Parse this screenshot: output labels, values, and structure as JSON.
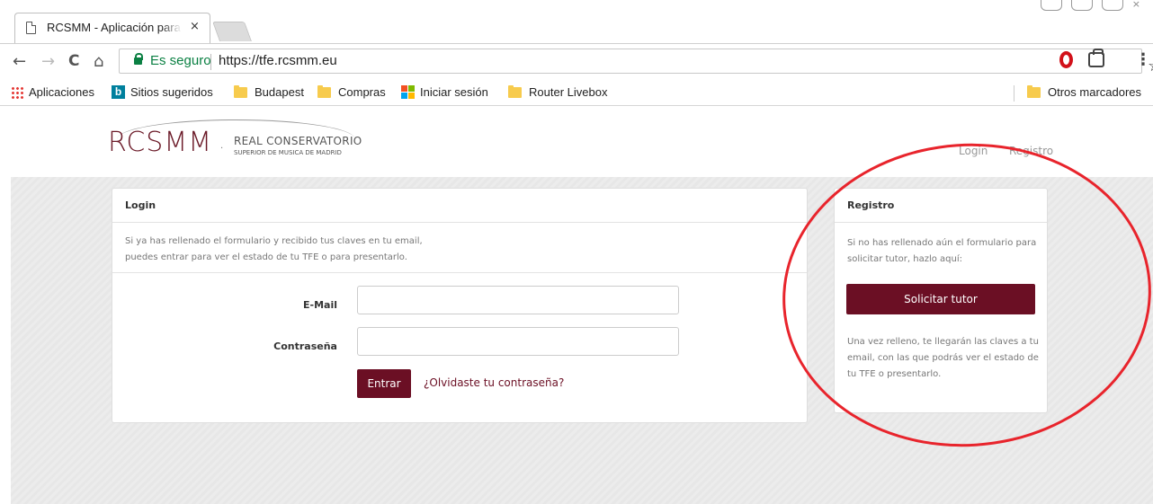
{
  "browser": {
    "tab_title": "RCSMM - Aplicación para",
    "tab_close": "×",
    "window_close": "×",
    "back": "←",
    "forward": "→",
    "reload": "C",
    "home": "⌂",
    "secure_label": "Es seguro",
    "url": "https://tfe.rcsmm.eu",
    "star": "☆",
    "menu": "⋮",
    "bookmarks": [
      {
        "label": "Aplicaciones"
      },
      {
        "label": "Sitios sugeridos"
      },
      {
        "label": "Budapest"
      },
      {
        "label": "Compras"
      },
      {
        "label": "Iniciar sesión"
      },
      {
        "label": "Router Livebox"
      }
    ],
    "other_bookmarks": "Otros marcadores",
    "secure_color": "#0b8043"
  },
  "site": {
    "logo_word": "RCSMM",
    "logo_dot": "·",
    "logo_line1": "REAL CONSERVATORIO",
    "logo_line2": "SUPERIOR DE MUSICA DE MADRID",
    "nav_login": "Login",
    "nav_registro": "Registro",
    "brand_color": "#6b0f24"
  },
  "login": {
    "title": "Login",
    "intro_line1": "Si ya has rellenado el formulario y recibido tus claves en tu email,",
    "intro_line2": "puedes entrar para ver el estado de tu TFE o para presentarlo.",
    "email_label": "E-Mail",
    "email_value": "",
    "password_label": "Contraseña",
    "password_value": "",
    "submit_label": "Entrar",
    "forgot_label": "¿Olvidaste tu contraseña?"
  },
  "registro": {
    "title": "Registro",
    "intro": "Si no has rellenado aún el formulario para solicitar tutor, hazlo aquí:",
    "button_label": "Solicitar tutor",
    "outro": "Una vez relleno, te llegarán las claves a tu email, con las que podrás ver el estado de tu TFE o presentarlo.",
    "annotation_color": "#e8242c"
  }
}
